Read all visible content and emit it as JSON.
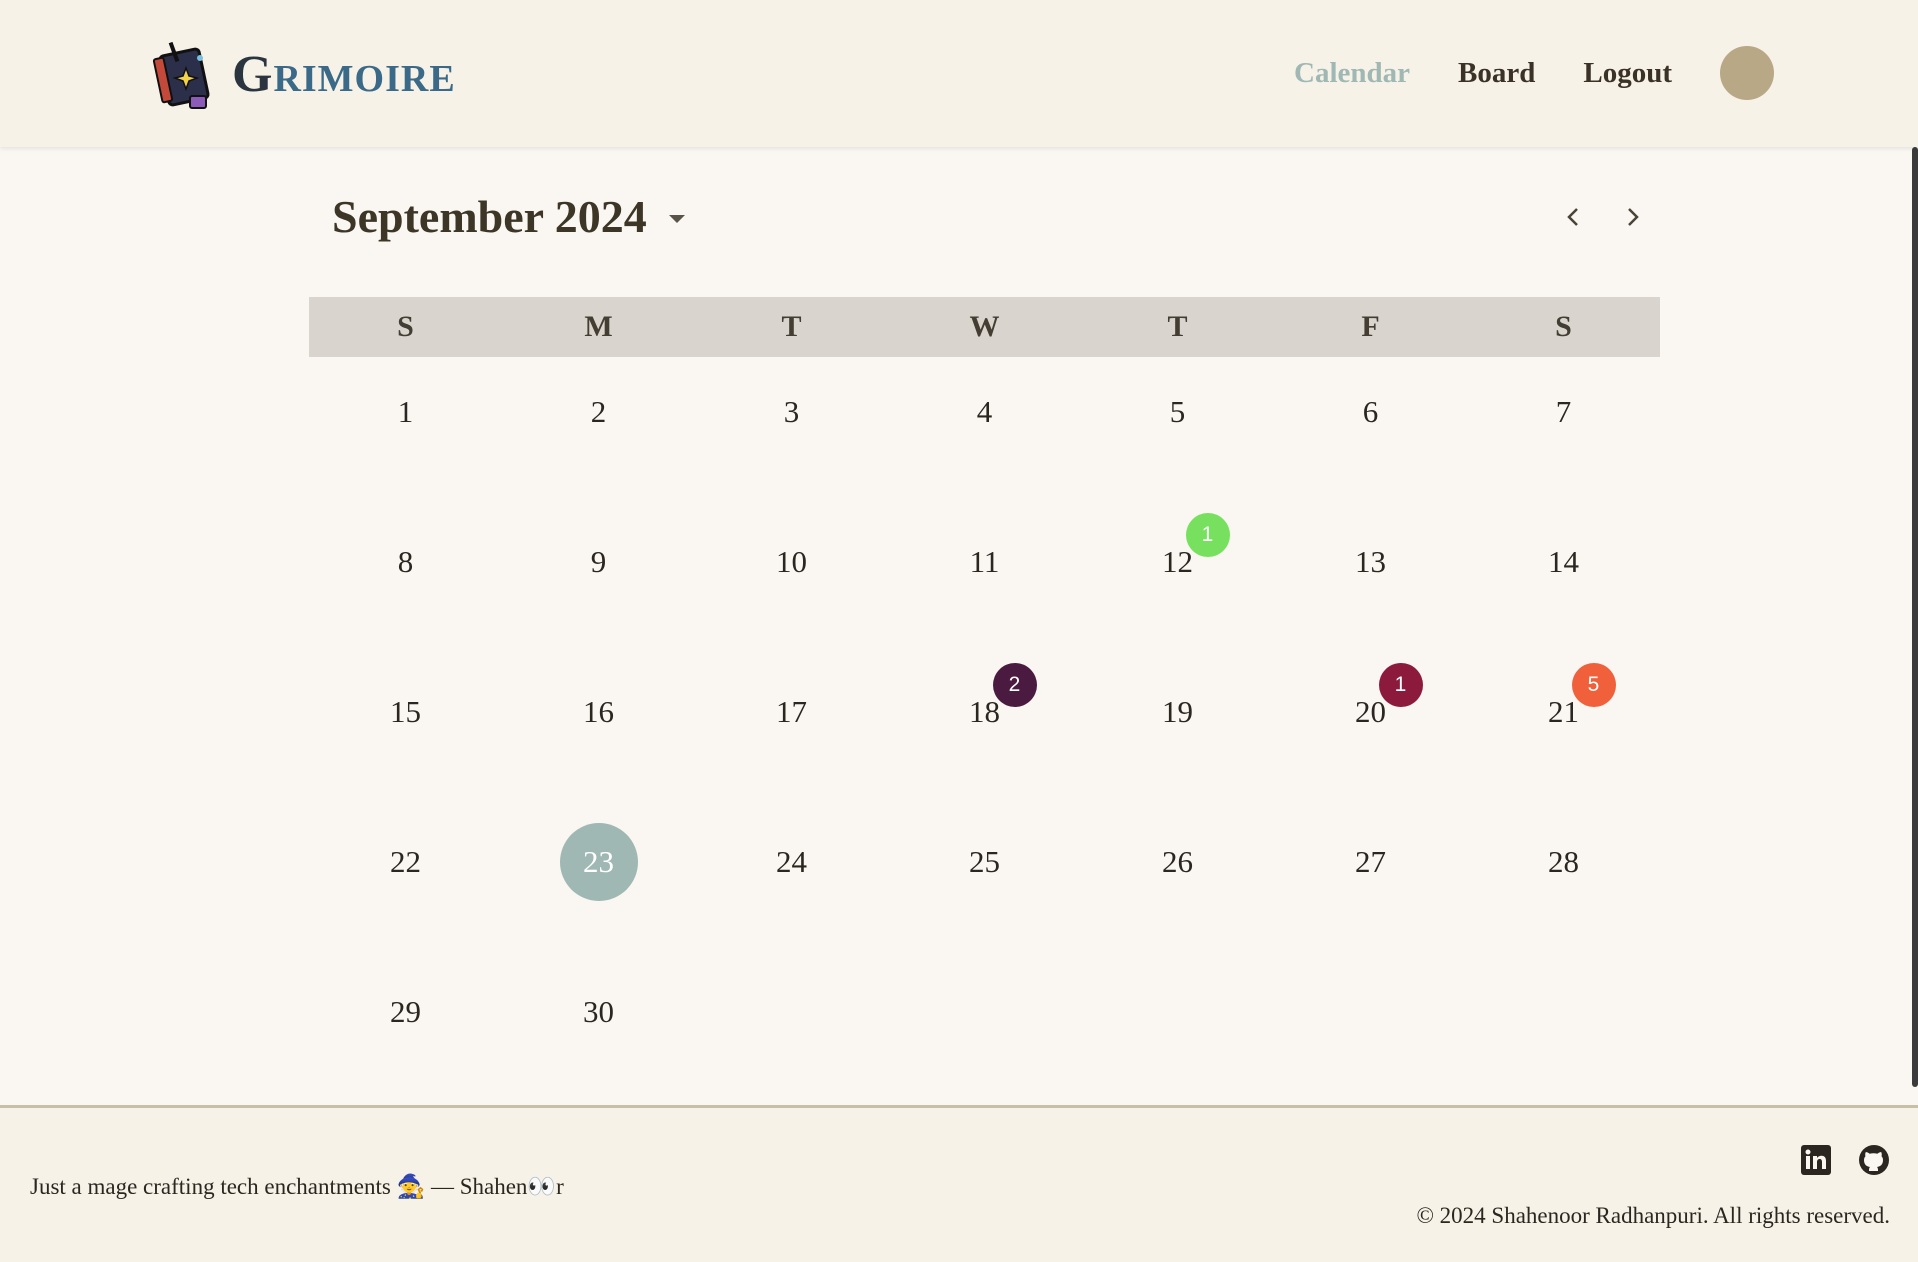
{
  "header": {
    "app_name_first": "G",
    "app_name_rest": "rimoire",
    "nav": [
      {
        "label": "Calendar",
        "active": true
      },
      {
        "label": "Board",
        "active": false
      },
      {
        "label": "Logout",
        "active": false
      }
    ]
  },
  "calendar": {
    "month_label": "September 2024",
    "weekdays": [
      "S",
      "M",
      "T",
      "W",
      "T",
      "F",
      "S"
    ],
    "days": [
      {
        "n": "1"
      },
      {
        "n": "2"
      },
      {
        "n": "3"
      },
      {
        "n": "4"
      },
      {
        "n": "5"
      },
      {
        "n": "6"
      },
      {
        "n": "7"
      },
      {
        "n": "8"
      },
      {
        "n": "9"
      },
      {
        "n": "10"
      },
      {
        "n": "11"
      },
      {
        "n": "12",
        "badge": "1",
        "badge_color": "#77e05e"
      },
      {
        "n": "13"
      },
      {
        "n": "14"
      },
      {
        "n": "15"
      },
      {
        "n": "16"
      },
      {
        "n": "17"
      },
      {
        "n": "18",
        "badge": "2",
        "badge_color": "#4b1a40"
      },
      {
        "n": "19"
      },
      {
        "n": "20",
        "badge": "1",
        "badge_color": "#8c1a3c"
      },
      {
        "n": "21",
        "badge": "5",
        "badge_color": "#f0603a"
      },
      {
        "n": "22"
      },
      {
        "n": "23",
        "today": true
      },
      {
        "n": "24"
      },
      {
        "n": "25"
      },
      {
        "n": "26"
      },
      {
        "n": "27"
      },
      {
        "n": "28"
      },
      {
        "n": "29"
      },
      {
        "n": "30"
      }
    ]
  },
  "footer": {
    "tagline": "Just a mage crafting tech enchantments 🧙 — Shahen👀r",
    "copyright": "© 2024 Shahenoor Radhanpuri. All rights reserved."
  },
  "colors": {
    "accent": "#9fb8b3",
    "avatar": "#b8a886"
  }
}
